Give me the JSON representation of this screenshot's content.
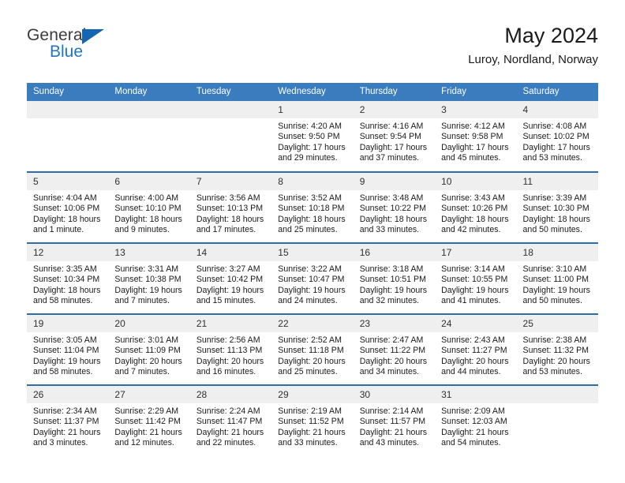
{
  "logo": {
    "word_top": "General",
    "word_bottom": "Blue",
    "accent_color": "#1565b0"
  },
  "header": {
    "title": "May 2024",
    "subtitle": "Luroy, Nordland, Norway"
  },
  "theme": {
    "header_bg": "#3a7cbe",
    "row_divider": "#2e6da8",
    "daynum_bg": "#efefef"
  },
  "weekdays": [
    "Sunday",
    "Monday",
    "Tuesday",
    "Wednesday",
    "Thursday",
    "Friday",
    "Saturday"
  ],
  "labels": {
    "sunrise": "Sunrise:",
    "sunset": "Sunset:",
    "daylight": "Daylight:"
  },
  "weeks": [
    [
      {
        "day": "",
        "sunrise": "",
        "sunset": "",
        "daylight": ""
      },
      {
        "day": "",
        "sunrise": "",
        "sunset": "",
        "daylight": ""
      },
      {
        "day": "",
        "sunrise": "",
        "sunset": "",
        "daylight": ""
      },
      {
        "day": "1",
        "sunrise": "Sunrise: 4:20 AM",
        "sunset": "Sunset: 9:50 PM",
        "daylight": "Daylight: 17 hours and 29 minutes."
      },
      {
        "day": "2",
        "sunrise": "Sunrise: 4:16 AM",
        "sunset": "Sunset: 9:54 PM",
        "daylight": "Daylight: 17 hours and 37 minutes."
      },
      {
        "day": "3",
        "sunrise": "Sunrise: 4:12 AM",
        "sunset": "Sunset: 9:58 PM",
        "daylight": "Daylight: 17 hours and 45 minutes."
      },
      {
        "day": "4",
        "sunrise": "Sunrise: 4:08 AM",
        "sunset": "Sunset: 10:02 PM",
        "daylight": "Daylight: 17 hours and 53 minutes."
      }
    ],
    [
      {
        "day": "5",
        "sunrise": "Sunrise: 4:04 AM",
        "sunset": "Sunset: 10:06 PM",
        "daylight": "Daylight: 18 hours and 1 minute."
      },
      {
        "day": "6",
        "sunrise": "Sunrise: 4:00 AM",
        "sunset": "Sunset: 10:10 PM",
        "daylight": "Daylight: 18 hours and 9 minutes."
      },
      {
        "day": "7",
        "sunrise": "Sunrise: 3:56 AM",
        "sunset": "Sunset: 10:13 PM",
        "daylight": "Daylight: 18 hours and 17 minutes."
      },
      {
        "day": "8",
        "sunrise": "Sunrise: 3:52 AM",
        "sunset": "Sunset: 10:18 PM",
        "daylight": "Daylight: 18 hours and 25 minutes."
      },
      {
        "day": "9",
        "sunrise": "Sunrise: 3:48 AM",
        "sunset": "Sunset: 10:22 PM",
        "daylight": "Daylight: 18 hours and 33 minutes."
      },
      {
        "day": "10",
        "sunrise": "Sunrise: 3:43 AM",
        "sunset": "Sunset: 10:26 PM",
        "daylight": "Daylight: 18 hours and 42 minutes."
      },
      {
        "day": "11",
        "sunrise": "Sunrise: 3:39 AM",
        "sunset": "Sunset: 10:30 PM",
        "daylight": "Daylight: 18 hours and 50 minutes."
      }
    ],
    [
      {
        "day": "12",
        "sunrise": "Sunrise: 3:35 AM",
        "sunset": "Sunset: 10:34 PM",
        "daylight": "Daylight: 18 hours and 58 minutes."
      },
      {
        "day": "13",
        "sunrise": "Sunrise: 3:31 AM",
        "sunset": "Sunset: 10:38 PM",
        "daylight": "Daylight: 19 hours and 7 minutes."
      },
      {
        "day": "14",
        "sunrise": "Sunrise: 3:27 AM",
        "sunset": "Sunset: 10:42 PM",
        "daylight": "Daylight: 19 hours and 15 minutes."
      },
      {
        "day": "15",
        "sunrise": "Sunrise: 3:22 AM",
        "sunset": "Sunset: 10:47 PM",
        "daylight": "Daylight: 19 hours and 24 minutes."
      },
      {
        "day": "16",
        "sunrise": "Sunrise: 3:18 AM",
        "sunset": "Sunset: 10:51 PM",
        "daylight": "Daylight: 19 hours and 32 minutes."
      },
      {
        "day": "17",
        "sunrise": "Sunrise: 3:14 AM",
        "sunset": "Sunset: 10:55 PM",
        "daylight": "Daylight: 19 hours and 41 minutes."
      },
      {
        "day": "18",
        "sunrise": "Sunrise: 3:10 AM",
        "sunset": "Sunset: 11:00 PM",
        "daylight": "Daylight: 19 hours and 50 minutes."
      }
    ],
    [
      {
        "day": "19",
        "sunrise": "Sunrise: 3:05 AM",
        "sunset": "Sunset: 11:04 PM",
        "daylight": "Daylight: 19 hours and 58 minutes."
      },
      {
        "day": "20",
        "sunrise": "Sunrise: 3:01 AM",
        "sunset": "Sunset: 11:09 PM",
        "daylight": "Daylight: 20 hours and 7 minutes."
      },
      {
        "day": "21",
        "sunrise": "Sunrise: 2:56 AM",
        "sunset": "Sunset: 11:13 PM",
        "daylight": "Daylight: 20 hours and 16 minutes."
      },
      {
        "day": "22",
        "sunrise": "Sunrise: 2:52 AM",
        "sunset": "Sunset: 11:18 PM",
        "daylight": "Daylight: 20 hours and 25 minutes."
      },
      {
        "day": "23",
        "sunrise": "Sunrise: 2:47 AM",
        "sunset": "Sunset: 11:22 PM",
        "daylight": "Daylight: 20 hours and 34 minutes."
      },
      {
        "day": "24",
        "sunrise": "Sunrise: 2:43 AM",
        "sunset": "Sunset: 11:27 PM",
        "daylight": "Daylight: 20 hours and 44 minutes."
      },
      {
        "day": "25",
        "sunrise": "Sunrise: 2:38 AM",
        "sunset": "Sunset: 11:32 PM",
        "daylight": "Daylight: 20 hours and 53 minutes."
      }
    ],
    [
      {
        "day": "26",
        "sunrise": "Sunrise: 2:34 AM",
        "sunset": "Sunset: 11:37 PM",
        "daylight": "Daylight: 21 hours and 3 minutes."
      },
      {
        "day": "27",
        "sunrise": "Sunrise: 2:29 AM",
        "sunset": "Sunset: 11:42 PM",
        "daylight": "Daylight: 21 hours and 12 minutes."
      },
      {
        "day": "28",
        "sunrise": "Sunrise: 2:24 AM",
        "sunset": "Sunset: 11:47 PM",
        "daylight": "Daylight: 21 hours and 22 minutes."
      },
      {
        "day": "29",
        "sunrise": "Sunrise: 2:19 AM",
        "sunset": "Sunset: 11:52 PM",
        "daylight": "Daylight: 21 hours and 33 minutes."
      },
      {
        "day": "30",
        "sunrise": "Sunrise: 2:14 AM",
        "sunset": "Sunset: 11:57 PM",
        "daylight": "Daylight: 21 hours and 43 minutes."
      },
      {
        "day": "31",
        "sunrise": "Sunrise: 2:09 AM",
        "sunset": "Sunset: 12:03 AM",
        "daylight": "Daylight: 21 hours and 54 minutes."
      },
      {
        "day": "",
        "sunrise": "",
        "sunset": "",
        "daylight": ""
      }
    ]
  ]
}
